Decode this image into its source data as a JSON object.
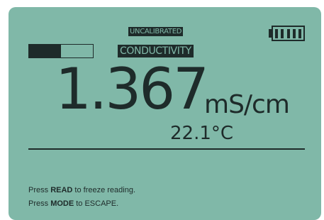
{
  "status": {
    "calibration_badge": "UNCALIBRATED",
    "mode_badge": "CONDUCTIVITY",
    "level_fraction": 0.5,
    "battery_segments": 5
  },
  "measurement": {
    "value": "1.367",
    "unit": "mS/cm",
    "temperature": "22.1°C"
  },
  "instructions": {
    "line1_prefix": "Press ",
    "line1_key": "READ",
    "line1_suffix": " to freeze reading.",
    "line2_prefix": "Press ",
    "line2_key": "MODE",
    "line2_suffix": " to ESCAPE."
  },
  "colors": {
    "screen_background": "#80b8a8",
    "foreground": "#1e2b2a"
  },
  "icons": {
    "battery": "battery-full-icon",
    "level": "level-bar-icon"
  }
}
